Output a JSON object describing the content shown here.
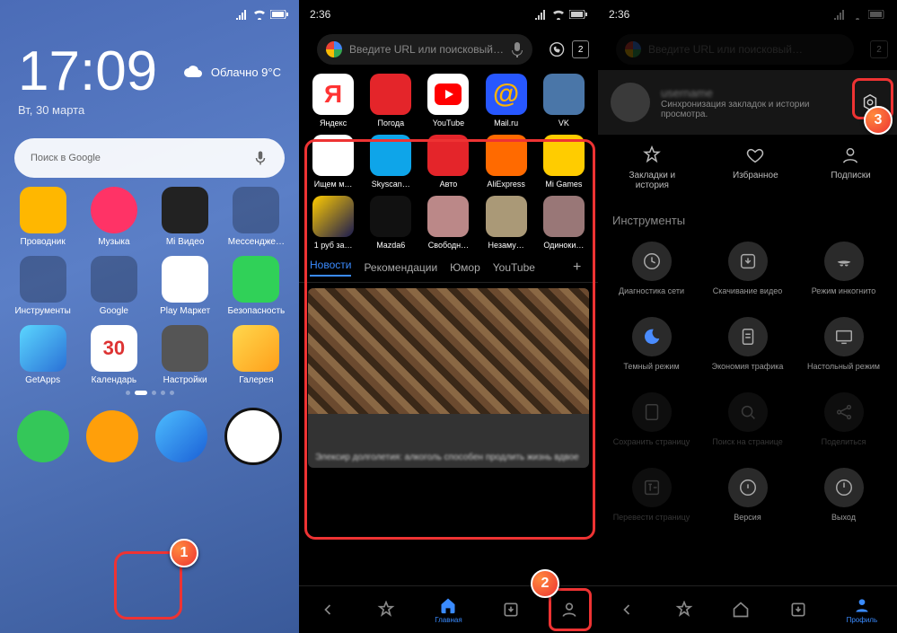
{
  "p1": {
    "time": "17:09",
    "date": "Вт, 30 марта",
    "weather": "Облачно  9°C",
    "search": "Поиск в Google",
    "rows": [
      [
        "Проводник",
        "Музыка",
        "Mi Видео",
        "Мессендже…"
      ],
      [
        "Инструменты",
        "Google",
        "Play Маркет",
        "Безопасность"
      ],
      [
        "GetApps",
        "Календарь",
        "Настройки",
        "Галерея"
      ]
    ]
  },
  "p2": {
    "time": "2:36",
    "url": "Введите URL или поисковый…",
    "tabcount": "2",
    "rowA": [
      "Яндекс",
      "Погода",
      "YouTube",
      "Mail.ru",
      "VK"
    ],
    "rowB": [
      "Ищем м…",
      "Skyscan…",
      "Авто",
      "AliExpress",
      "Mi Games"
    ],
    "rowC": [
      "1 руб за…",
      "Mazda6",
      "Свободн…",
      "Незаму…",
      "Одиноки…"
    ],
    "tabs": [
      "Новости",
      "Рекомендации",
      "Юмор",
      "YouTube"
    ],
    "feed": "Элексир долголетия: алкоголь способен продлить жизнь вдвое",
    "bot": [
      "",
      "",
      "Главная",
      "",
      ""
    ]
  },
  "p3": {
    "time": "2:36",
    "url": "Введите URL или поисковый…",
    "name": "username",
    "sub": "Синхронизация закладок и истории просмотра.",
    "row3": [
      "Закладки и история",
      "Избранное",
      "Подписки"
    ],
    "sect": "Инструменты",
    "tools": [
      "Диагностика сети",
      "Скачивание видео",
      "Режим инкогнито",
      "Темный режим",
      "Экономия трафика",
      "Настольный режим",
      "Сохранить страницу",
      "Поиск на странице",
      "Поделиться",
      "Перевести страницу",
      "Версия",
      "Выход"
    ],
    "bot": [
      "",
      "",
      "",
      "",
      "Профиль"
    ]
  },
  "markers": {
    "m1": "1",
    "m2": "2",
    "m3": "3"
  }
}
